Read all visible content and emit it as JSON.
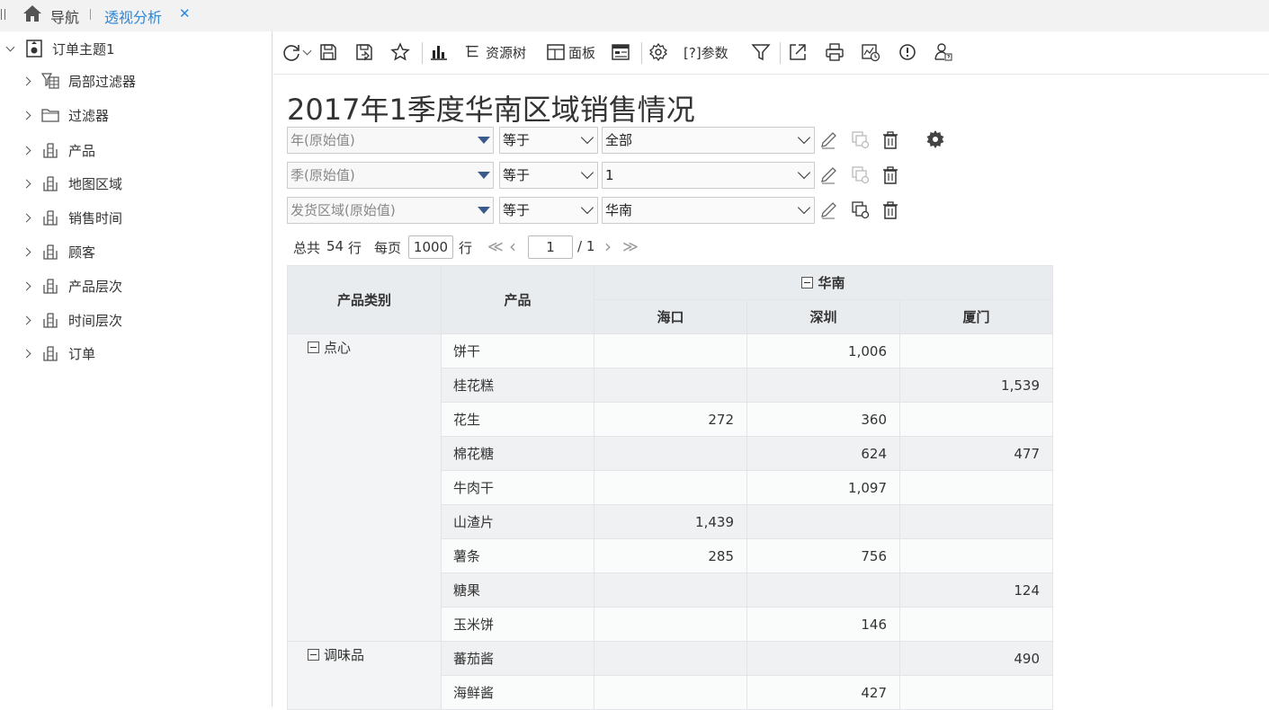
{
  "topbar": {
    "nav_label": "导航",
    "tab_label": "透视分析",
    "tab_close": "✕"
  },
  "sidebar": {
    "root_label": "订单主题1",
    "items": [
      {
        "label": "局部过滤器",
        "icon": "filter-table-icon"
      },
      {
        "label": "过滤器",
        "icon": "folder-icon"
      },
      {
        "label": "产品",
        "icon": "table-icon"
      },
      {
        "label": "地图区域",
        "icon": "table-icon"
      },
      {
        "label": "销售时间",
        "icon": "table-icon"
      },
      {
        "label": "顾客",
        "icon": "table-icon"
      },
      {
        "label": "产品层次",
        "icon": "table-icon"
      },
      {
        "label": "时间层次",
        "icon": "table-icon"
      },
      {
        "label": "订单",
        "icon": "table-icon"
      }
    ]
  },
  "toolbar": {
    "resource_tree": "资源树",
    "panel": "面板",
    "params": "[?]参数"
  },
  "report": {
    "title": "2017年1季度华南区域销售情况"
  },
  "filters": [
    {
      "field": "年(原始值)",
      "op": "等于",
      "value": "全部"
    },
    {
      "field": "季(原始值)",
      "op": "等于",
      "value": "1"
    },
    {
      "field": "发货区域(原始值)",
      "op": "等于",
      "value": "华南"
    }
  ],
  "pager": {
    "total_prefix": "总共",
    "total": "54",
    "row_unit": "行",
    "per_page_label": "每页",
    "per_page": "1000",
    "page": "1",
    "pages": "/ 1",
    "first": "≪",
    "prev": "‹",
    "next": "›",
    "last": "≫"
  },
  "table": {
    "header_category": "产品类别",
    "header_product": "产品",
    "region": "华南",
    "cities": [
      "海口",
      "深圳",
      "厦门"
    ],
    "rows": [
      {
        "category": "点心",
        "product": "饼干",
        "values": [
          "",
          "1,006",
          ""
        ]
      },
      {
        "category": "",
        "product": "桂花糕",
        "values": [
          "",
          "",
          "1,539"
        ]
      },
      {
        "category": "",
        "product": "花生",
        "values": [
          "272",
          "360",
          ""
        ]
      },
      {
        "category": "",
        "product": "棉花糖",
        "values": [
          "",
          "624",
          "477"
        ]
      },
      {
        "category": "",
        "product": "牛肉干",
        "values": [
          "",
          "1,097",
          ""
        ]
      },
      {
        "category": "",
        "product": "山渣片",
        "values": [
          "1,439",
          "",
          ""
        ]
      },
      {
        "category": "",
        "product": "薯条",
        "values": [
          "285",
          "756",
          ""
        ]
      },
      {
        "category": "",
        "product": "糖果",
        "values": [
          "",
          "",
          "124"
        ]
      },
      {
        "category": "",
        "product": "玉米饼",
        "values": [
          "",
          "146",
          ""
        ]
      },
      {
        "category": "调味品",
        "product": "蕃茄酱",
        "values": [
          "",
          "",
          "490"
        ]
      },
      {
        "category": "",
        "product": "海鲜酱",
        "values": [
          "",
          "427",
          ""
        ]
      }
    ]
  }
}
